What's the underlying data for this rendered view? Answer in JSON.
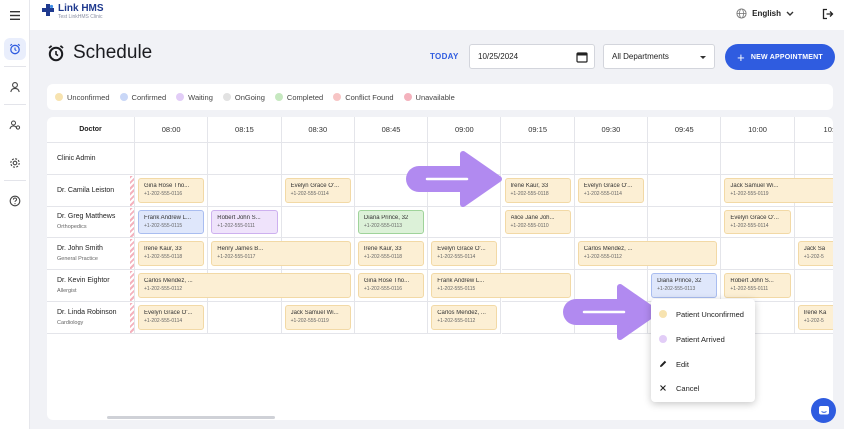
{
  "app": {
    "name": "Link HMS",
    "subtitle": "Test LinkHMS Clinic"
  },
  "topbar": {
    "language": "English"
  },
  "page": {
    "title": "Schedule",
    "today_label": "TODAY",
    "date_value": "10/25/2024",
    "department": "All Departments",
    "new_appointment_label": "NEW APPOINTMENT"
  },
  "legend": [
    {
      "label": "Unconfirmed",
      "color": "#f7e3b0"
    },
    {
      "label": "Confirmed",
      "color": "#c9d7f7"
    },
    {
      "label": "Waiting",
      "color": "#e2cdf7"
    },
    {
      "label": "OnGoing",
      "color": "#e2e2e2"
    },
    {
      "label": "Completed",
      "color": "#c6e8c0"
    },
    {
      "label": "Conflict Found",
      "color": "#f7c5c5"
    },
    {
      "label": "Unavailable",
      "color": "#f4b2bd"
    }
  ],
  "grid": {
    "doctor_header": "Doctor",
    "times": [
      "08:00",
      "08:15",
      "08:30",
      "08:45",
      "09:00",
      "09:15",
      "09:30",
      "09:45",
      "10:00",
      "10:1"
    ],
    "doctors": [
      {
        "name": "Clinic Admin",
        "specialty": ""
      },
      {
        "name": "Dr. Camila Leiston",
        "specialty": ""
      },
      {
        "name": "Dr. Greg Matthews",
        "specialty": "Orthopedics"
      },
      {
        "name": "Dr. John Smith",
        "specialty": "General Practice"
      },
      {
        "name": "Dr. Kevin Eightor",
        "specialty": "Allergist"
      },
      {
        "name": "Dr. Linda Robinson",
        "specialty": "Cardiology"
      }
    ],
    "appointments": [
      {
        "row": 1,
        "slot": 0,
        "span": 1,
        "name": "Gina Rose Tho...",
        "phone": "+1-202-555-0116",
        "status": "unconfirmed"
      },
      {
        "row": 1,
        "slot": 2,
        "span": 1,
        "name": "Evelyn Grace O'...",
        "phone": "+1-202-555-0114",
        "status": "unconfirmed"
      },
      {
        "row": 1,
        "slot": 5,
        "span": 1,
        "name": "Irene Kaur, 33",
        "phone": "+1-202-555-0118",
        "status": "unconfirmed"
      },
      {
        "row": 1,
        "slot": 6,
        "span": 1,
        "name": "Evelyn Grace O'...",
        "phone": "+1-202-555-0114",
        "status": "unconfirmed"
      },
      {
        "row": 1,
        "slot": 8,
        "span": 2,
        "name": "Jack Samuel Wi...",
        "phone": "+1-202-555-0119",
        "status": "unconfirmed"
      },
      {
        "row": 2,
        "slot": 0,
        "span": 1,
        "name": "Frank Andrew L...",
        "phone": "+1-202-555-0115",
        "status": "confirmed"
      },
      {
        "row": 2,
        "slot": 1,
        "span": 1,
        "name": "Robert John S...",
        "phone": "+1-202-555-0111",
        "status": "waiting"
      },
      {
        "row": 2,
        "slot": 3,
        "span": 1,
        "name": "Diana Prince, 32",
        "phone": "+1-202-555-0113",
        "status": "completed"
      },
      {
        "row": 2,
        "slot": 5,
        "span": 1,
        "name": "Alice Jane Joh...",
        "phone": "+1-202-555-0110",
        "status": "unconfirmed"
      },
      {
        "row": 2,
        "slot": 8,
        "span": 1,
        "name": "Evelyn Grace O'...",
        "phone": "+1-202-555-0114",
        "status": "unconfirmed"
      },
      {
        "row": 3,
        "slot": 0,
        "span": 1,
        "name": "Irene Kaur, 33",
        "phone": "+1-202-555-0118",
        "status": "unconfirmed"
      },
      {
        "row": 3,
        "slot": 1,
        "span": 2,
        "name": "Henry James B...",
        "phone": "+1-202-555-0117",
        "status": "unconfirmed"
      },
      {
        "row": 3,
        "slot": 3,
        "span": 1,
        "name": "Irene Kaur, 33",
        "phone": "+1-202-555-0118",
        "status": "unconfirmed"
      },
      {
        "row": 3,
        "slot": 4,
        "span": 1,
        "name": "Evelyn Grace O'...",
        "phone": "+1-202-555-0114",
        "status": "unconfirmed"
      },
      {
        "row": 3,
        "slot": 6,
        "span": 2,
        "name": "Carlos Mendez, ...",
        "phone": "+1-202-555-0112",
        "status": "unconfirmed"
      },
      {
        "row": 3,
        "slot": 9,
        "span": 1,
        "name": "Jack Sa",
        "phone": "+1-202-5",
        "status": "unconfirmed"
      },
      {
        "row": 4,
        "slot": 0,
        "span": 3,
        "name": "Carlos Mendez, ...",
        "phone": "+1-202-555-0112",
        "status": "unconfirmed"
      },
      {
        "row": 4,
        "slot": 3,
        "span": 1,
        "name": "Gina Rose Tho...",
        "phone": "+1-202-555-0116",
        "status": "unconfirmed"
      },
      {
        "row": 4,
        "slot": 4,
        "span": 2,
        "name": "Frank Andrew L...",
        "phone": "+1-202-555-0115",
        "status": "unconfirmed"
      },
      {
        "row": 4,
        "slot": 7,
        "span": 1,
        "name": "Diana Prince, 32",
        "phone": "+1-202-555-0113",
        "status": "confirmed"
      },
      {
        "row": 4,
        "slot": 8,
        "span": 1,
        "name": "Robert John S...",
        "phone": "+1-202-555-0111",
        "status": "unconfirmed"
      },
      {
        "row": 5,
        "slot": 0,
        "span": 1,
        "name": "Evelyn Grace O'...",
        "phone": "+1-202-555-0114",
        "status": "unconfirmed"
      },
      {
        "row": 5,
        "slot": 2,
        "span": 1,
        "name": "Jack Samuel Wi...",
        "phone": "+1-202-555-0119",
        "status": "unconfirmed"
      },
      {
        "row": 5,
        "slot": 4,
        "span": 1,
        "name": "Carlos Mendez, ...",
        "phone": "+1-202-555-0112",
        "status": "unconfirmed"
      },
      {
        "row": 5,
        "slot": 9,
        "span": 1,
        "name": "Irene Ka",
        "phone": "+1-202-5",
        "status": "unconfirmed"
      }
    ]
  },
  "context_menu": {
    "items": [
      {
        "label": "Patient Unconfirmed",
        "icon": "unconfirmed-dot-icon",
        "color": "#f7e3b0"
      },
      {
        "label": "Patient Arrived",
        "icon": "arrived-dot-icon",
        "color": "#e2cdf7"
      },
      {
        "label": "Edit",
        "icon": "pencil-icon"
      },
      {
        "label": "Cancel",
        "icon": "close-icon"
      }
    ]
  },
  "colors": {
    "accent": "#2f5ce0",
    "arrow": "#b18af0"
  }
}
